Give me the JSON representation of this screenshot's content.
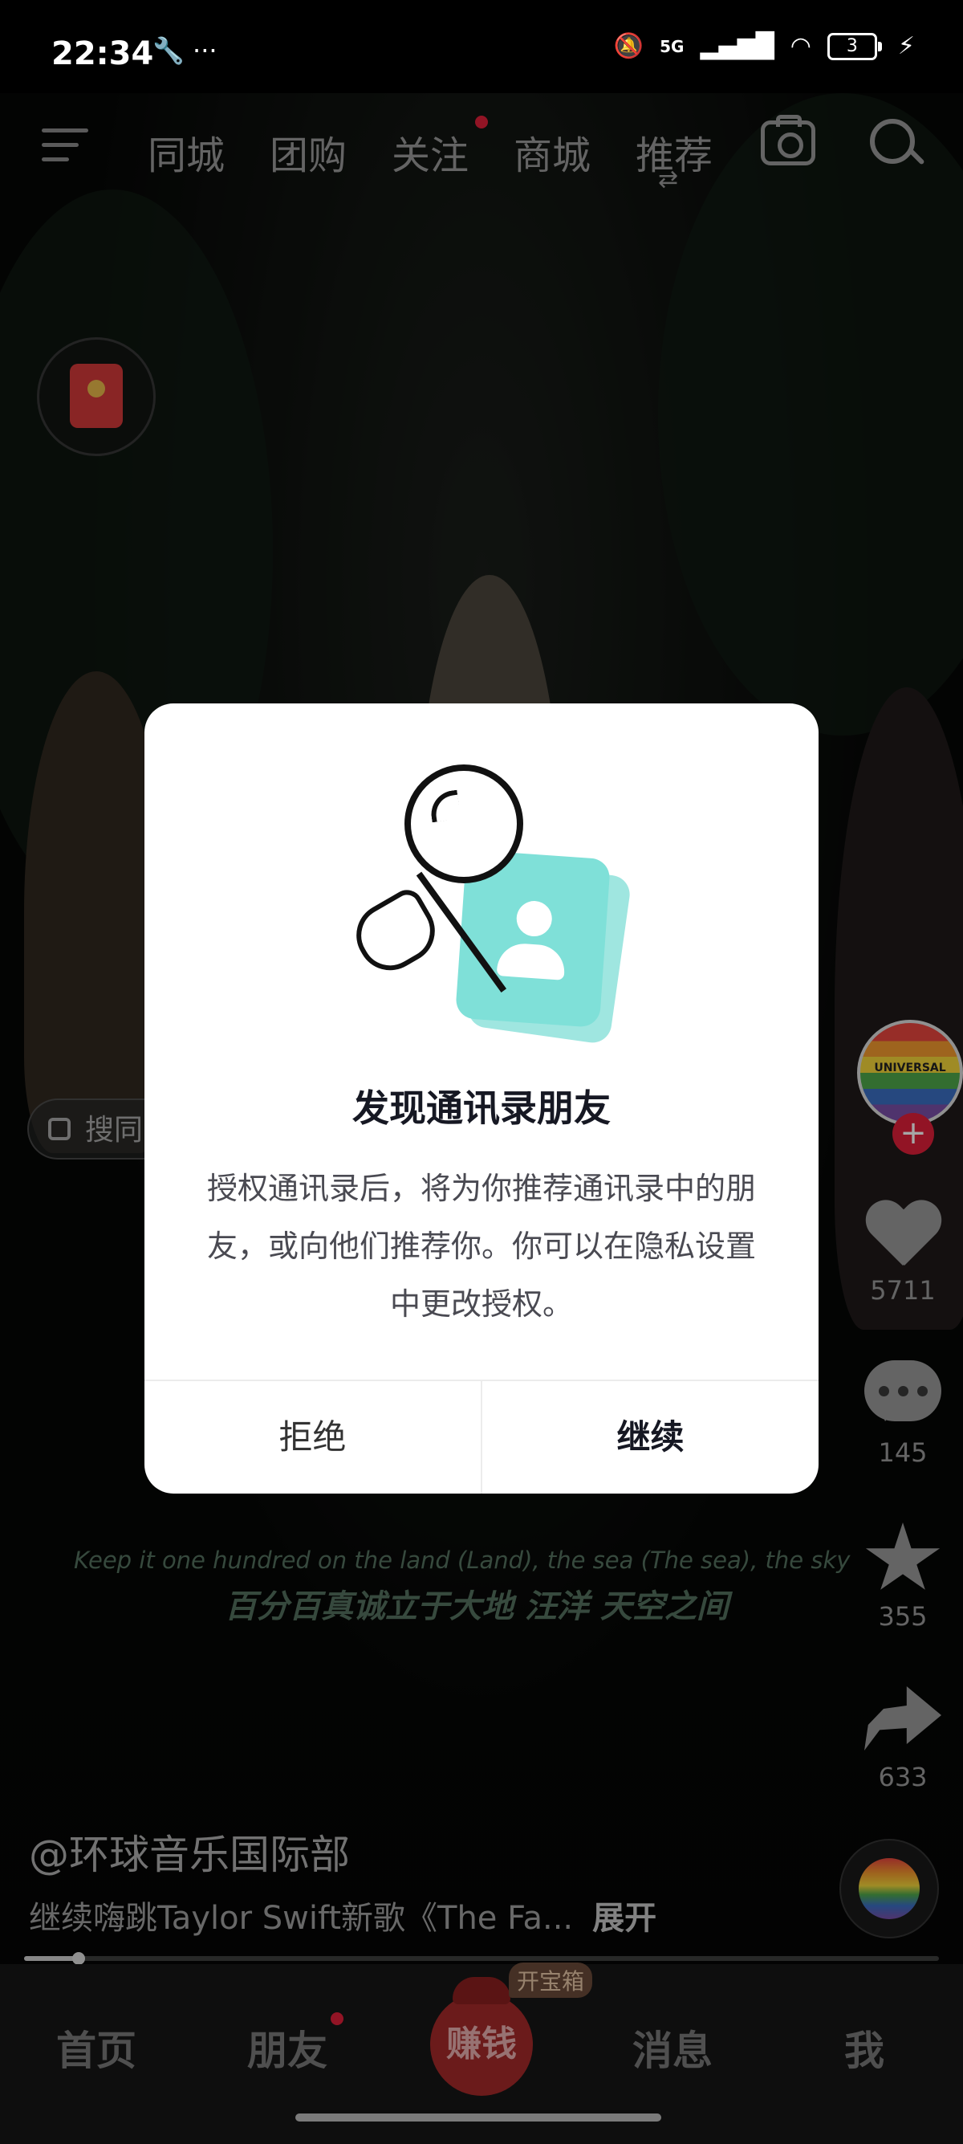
{
  "status_bar": {
    "time": "22:34",
    "left_icons": "🔧 ···",
    "network": "5G",
    "battery_level": "3"
  },
  "top_nav": {
    "tabs": [
      {
        "label": "同城"
      },
      {
        "label": "团购"
      },
      {
        "label": "关注"
      },
      {
        "label": "商城"
      },
      {
        "label": "推荐"
      }
    ],
    "active_tab": "推荐",
    "has_follow_dot": true
  },
  "search_chip": {
    "label": "搜同"
  },
  "right_rail": {
    "avatar_text": "UNIVERSAL",
    "follow_plus": "+",
    "likes": "5711",
    "comments": "145",
    "favorites": "355",
    "shares": "633"
  },
  "subtitles": {
    "english": "Keep it one hundred on the land (Land), the sea (The sea), the sky",
    "chinese": "百分百真诚立于大地 汪洋 天空之间"
  },
  "video_info": {
    "author": "@环球音乐国际部",
    "description": "继续嗨跳Taylor Swift新歌《The Fa...",
    "expand_label": "展开",
    "progress": 0.06
  },
  "bottom_nav": {
    "home": "首页",
    "friends": "朋友",
    "earn": "赚钱",
    "earn_badge": "开宝箱",
    "messages": "消息",
    "me": "我"
  },
  "modal": {
    "title": "发现通讯录朋友",
    "body": "授权通讯录后，将为你推荐通讯录中的朋友，或向他们推荐你。你可以在隐私设置中更改授权。",
    "reject_label": "拒绝",
    "continue_label": "继续"
  },
  "colors": {
    "accent_red": "#e0203a",
    "contact_card": "#7fe0d8"
  }
}
